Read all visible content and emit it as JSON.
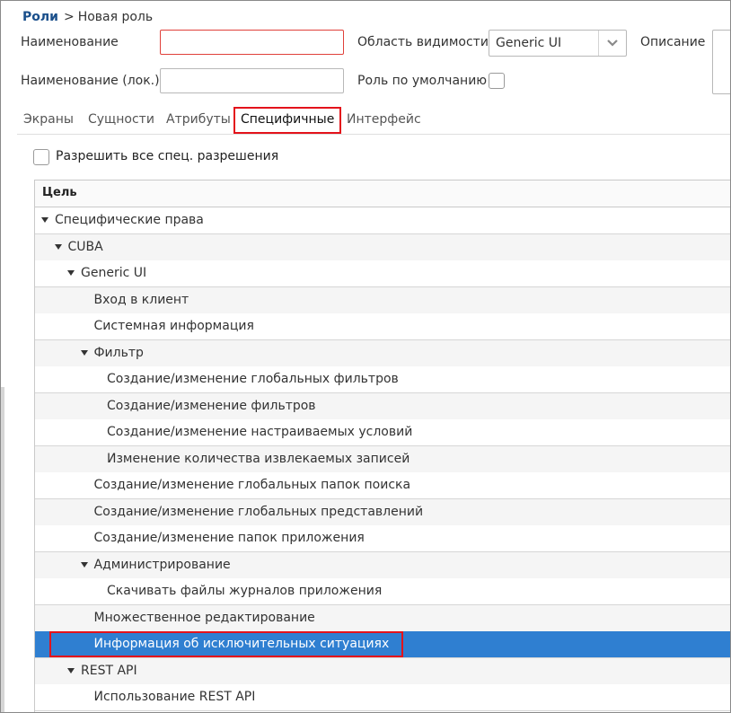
{
  "breadcrumb": {
    "link": "Роли",
    "separator": ">",
    "current": "Новая роль"
  },
  "form": {
    "name_label": "Наименование",
    "name_value": "",
    "loc_name_label": "Наименование (лок.)",
    "loc_name_value": "",
    "scope_label": "Область видимости",
    "scope_value": "Generic UI",
    "default_role_label": "Роль по умолчанию",
    "default_role_checked": false,
    "description_label": "Описание"
  },
  "tabs": [
    {
      "label": "Экраны"
    },
    {
      "label": "Сущности"
    },
    {
      "label": "Атрибуты"
    },
    {
      "label": "Специфичные",
      "active": true
    },
    {
      "label": "Интерфейс"
    }
  ],
  "permissions": {
    "allow_all_label": "Разрешить все спец. разрешения",
    "allow_all_checked": false
  },
  "table": {
    "column_header": "Цель",
    "rows": [
      {
        "label": "Специфические права",
        "level": 0,
        "expanded": true
      },
      {
        "label": "CUBA",
        "level": 1,
        "expanded": true
      },
      {
        "label": "Generic UI",
        "level": 2,
        "expanded": true
      },
      {
        "label": "Вход в клиент",
        "level": 3
      },
      {
        "label": "Системная информация",
        "level": 3
      },
      {
        "label": "Фильтр",
        "level": 3,
        "expanded": true
      },
      {
        "label": "Создание/изменение глобальных фильтров",
        "level": 4
      },
      {
        "label": "Создание/изменение фильтров",
        "level": 4
      },
      {
        "label": "Создание/изменение настраиваемых условий",
        "level": 4
      },
      {
        "label": "Изменение количества извлекаемых записей",
        "level": 4
      },
      {
        "label": "Создание/изменение глобальных папок поиска",
        "level": 3
      },
      {
        "label": "Создание/изменение глобальных представлений",
        "level": 3
      },
      {
        "label": "Создание/изменение папок приложения",
        "level": 3
      },
      {
        "label": "Администрирование",
        "level": 3,
        "expanded": true
      },
      {
        "label": "Скачивать файлы журналов приложения",
        "level": 4
      },
      {
        "label": "Множественное редактирование",
        "level": 3
      },
      {
        "label": "Информация об исключительных ситуациях",
        "level": 3,
        "selected": true
      },
      {
        "label": "REST API",
        "level": 2,
        "expanded": true
      },
      {
        "label": "Использование REST API",
        "level": 3
      }
    ]
  },
  "colors": {
    "selected_row": "#2f7fd1",
    "highlight_border": "#e3131b",
    "breadcrumb_link": "#1a4f8b",
    "error_border": "#e0403a"
  },
  "icons": {
    "scope_dropdown": "chevron-down-icon",
    "tree_toggle": "caret-down-icon"
  }
}
